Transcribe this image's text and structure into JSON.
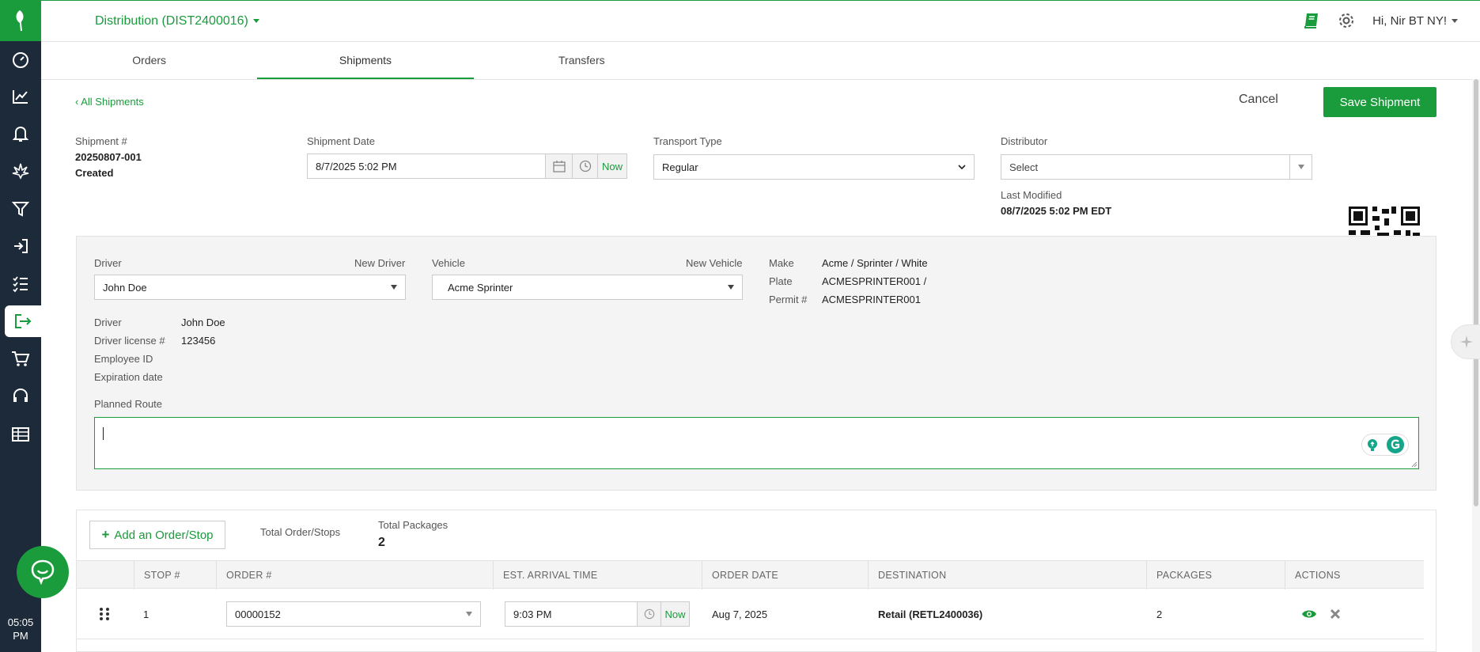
{
  "header": {
    "distribution_title": "Distribution (DIST2400016)",
    "greeting": "Hi, Nir BT NY!"
  },
  "tabs": [
    {
      "label": "Orders"
    },
    {
      "label": "Shipments"
    },
    {
      "label": "Transfers"
    }
  ],
  "actions": {
    "back_label": "All Shipments",
    "cancel_label": "Cancel",
    "save_label": "Save Shipment"
  },
  "shipment": {
    "number_label": "Shipment #",
    "number": "20250807-001",
    "status": "Created",
    "date_label": "Shipment Date",
    "date_value": "8/7/2025 5:02 PM",
    "now_label": "Now",
    "transport_label": "Transport Type",
    "transport_value": "Regular",
    "distributor_label": "Distributor",
    "distributor_value": "Select",
    "last_modified_label": "Last Modified",
    "last_modified_value": "08/7/2025 5:02 PM EDT"
  },
  "driver_section": {
    "driver_label": "Driver",
    "new_driver": "New Driver",
    "driver_value": "John Doe",
    "vehicle_label": "Vehicle",
    "new_vehicle": "New Vehicle",
    "vehicle_value": "Acme Sprinter",
    "make_label": "Make",
    "make_value": "Acme / Sprinter / White",
    "plate_label": "Plate",
    "plate_value": "ACMESPRINTER001 /",
    "permit_label": "Permit #",
    "permit_value": "ACMESPRINTER001",
    "info_driver_label": "Driver",
    "info_driver_value": "John Doe",
    "license_label": "Driver license #",
    "license_value": "123456",
    "employee_label": "Employee ID",
    "expiration_label": "Expiration date",
    "route_label": "Planned Route"
  },
  "orders": {
    "add_label": "Add an Order/Stop",
    "total_stops_label": "Total Order/Stops",
    "total_packages_label": "Total Packages",
    "total_packages_value": "2",
    "columns": [
      "STOP #",
      "ORDER #",
      "EST. ARRIVAL TIME",
      "ORDER DATE",
      "DESTINATION",
      "PACKAGES",
      "ACTIONS"
    ],
    "rows": [
      {
        "stop": "1",
        "order": "00000152",
        "arrival": "9:03 PM",
        "now": "Now",
        "order_date": "Aug 7, 2025",
        "destination": "Retail (RETL2400036)",
        "packages": "2"
      }
    ]
  },
  "clock": {
    "time": "05:05",
    "period": "PM"
  },
  "colors": {
    "brand_green": "#1a9b3c",
    "sidebar": "#1c2a3a"
  }
}
